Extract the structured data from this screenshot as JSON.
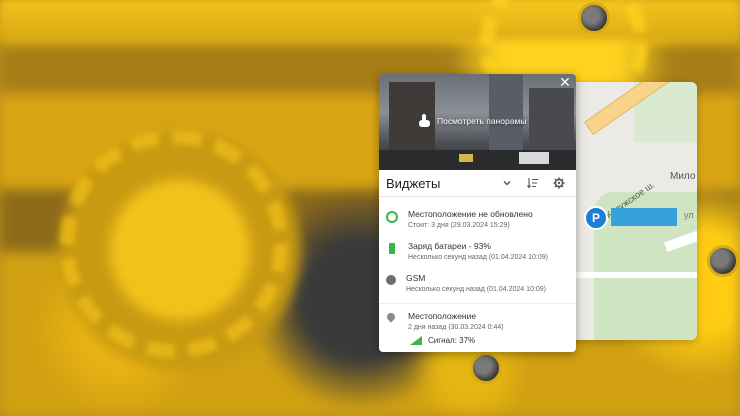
{
  "panorama": {
    "link_label": "Посмотреть панорамы"
  },
  "widgets": {
    "title": "Виджеты",
    "items": [
      {
        "primary": "Местоположение не обновлено",
        "secondary": "Стоит: 3 дня (29.03.2024 15:29)",
        "icon": "ring-icon",
        "color": "#39b54a"
      },
      {
        "primary": "Заряд батареи - 93%",
        "secondary": "Несколько секунд назад (01.04.2024 10:09)",
        "icon": "battery-icon",
        "color": "#39b54a"
      },
      {
        "primary": "GSM",
        "secondary": "Несколько секунд назад (01.04.2024 10:09)",
        "icon": "gsm-dot-icon",
        "color": "#6d6d6d"
      }
    ],
    "location": {
      "primary": "Местоположение",
      "secondary": "2 дня назад (30.03.2024 0:44)",
      "signal": "Сигнал: 37%"
    }
  },
  "map": {
    "street1": "Калужское ш.",
    "street2": "Мило",
    "street3": "ул",
    "parking_label": "P"
  },
  "close_label": "✕"
}
